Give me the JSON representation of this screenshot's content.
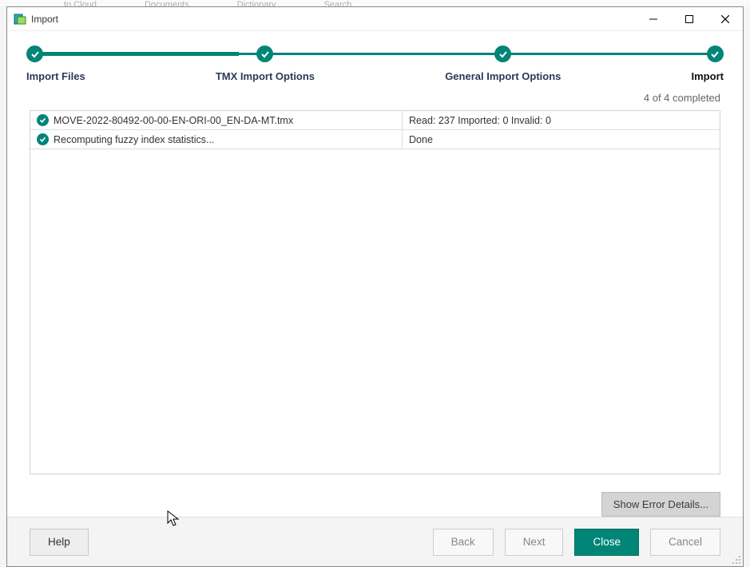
{
  "window": {
    "title": "Import"
  },
  "stepper": {
    "steps": [
      {
        "label": "Import Files"
      },
      {
        "label": "TMX Import Options"
      },
      {
        "label": "General Import Options"
      },
      {
        "label": "Import"
      }
    ]
  },
  "progress_text": "4 of 4 completed",
  "rows": [
    {
      "name": "MOVE-2022-80492-00-00-EN-ORI-00_EN-DA-MT.tmx",
      "status": "Read: 237 Imported: 0 Invalid: 0"
    },
    {
      "name": "Recomputing fuzzy index statistics...",
      "status": "Done"
    }
  ],
  "buttons": {
    "show_error_details": "Show Error Details...",
    "help": "Help",
    "back": "Back",
    "next": "Next",
    "close": "Close",
    "cancel": "Cancel"
  },
  "bg_menu": [
    "to Cloud",
    "Documents",
    "Dictionary",
    "",
    "Search"
  ]
}
